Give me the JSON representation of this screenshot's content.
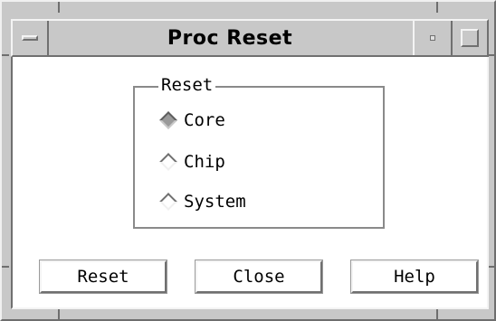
{
  "window": {
    "title": "Proc Reset",
    "controls": {
      "window_menu_icon": "window-menu-icon",
      "minimize_icon": "minimize-icon",
      "maximize_icon": "maximize-icon"
    }
  },
  "reset_group": {
    "label": "Reset",
    "selected": "Core",
    "options": [
      {
        "label": "Core",
        "selected": true
      },
      {
        "label": "Chip",
        "selected": false
      },
      {
        "label": "System",
        "selected": false
      }
    ]
  },
  "buttons": {
    "reset_label": "Reset",
    "close_label": "Close",
    "help_label": "Help"
  },
  "colors": {
    "frame": "#c8c8c8",
    "client": "#ffffff",
    "shadow": "#707070",
    "highlight": "#f4f4f4",
    "selected_radio": "#9a9a9a"
  }
}
